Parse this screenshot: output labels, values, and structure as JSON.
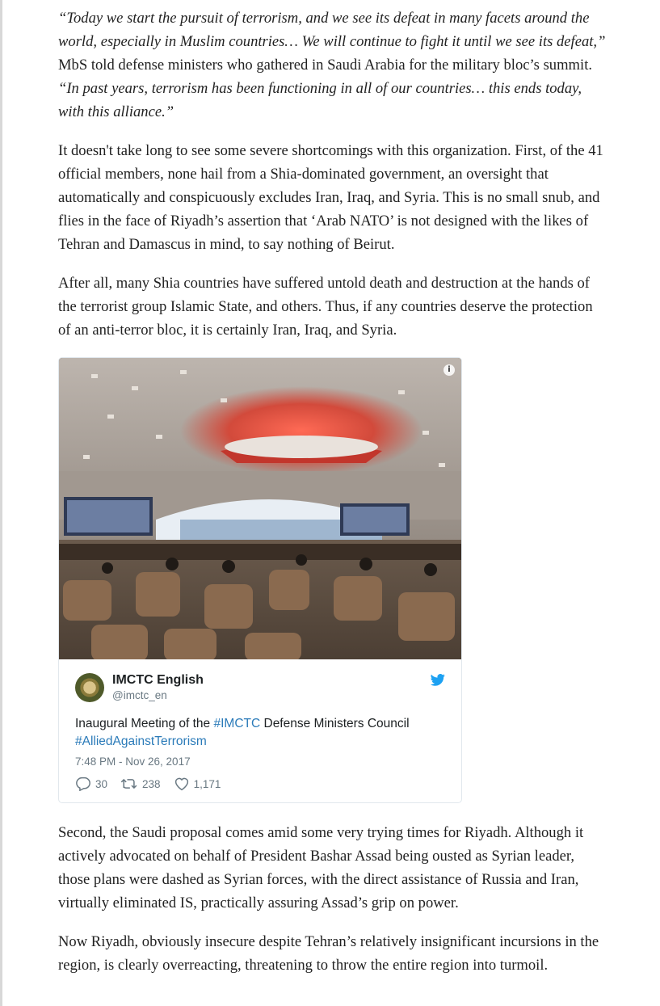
{
  "article": {
    "p1": {
      "q1": "“Today we start the pursuit of terrorism, and we see its defeat in many facets around the world, especially in Muslim countries… We will continue to fight it until we see its defeat,”",
      "plain": " MbS told defense ministers who gathered in Saudi Arabia for the military bloc’s summit. ",
      "q2": "“In past years, terrorism has been functioning in all of our countries… this ends today, with this alliance.”"
    },
    "p2": "It doesn't take long to see some severe shortcomings with this organization. First, of the 41 official members, none hail from a Shia-dominated government, an oversight that automatically and conspicuously excludes Iran, Iraq, and Syria. This is no small snub, and flies in the face of Riyadh’s assertion that ‘Arab NATO’ is not designed with the likes of Tehran and Damascus in mind, to say nothing of Beirut.",
    "p3": "After all, many Shia countries have suffered untold death and destruction at the hands of the terrorist group Islamic State, and others. Thus, if any countries deserve the protection of an anti-terror bloc, it is certainly Iran, Iraq, and Syria.",
    "p4": "Second, the Saudi proposal comes amid some very trying times for Riyadh. Although it actively advocated on behalf of President Bashar Assad being ousted as Syrian leader, those plans were dashed as Syrian forces, with the direct assistance of Russia and Iran, virtually eliminated IS, practically assuring Assad’s grip on power.",
    "p5": "Now Riyadh, obviously insecure despite Tehran’s relatively insignificant incursions in the region, is clearly overreacting, threatening to throw the entire region into turmoil."
  },
  "tweet": {
    "display_name": "IMCTC English",
    "handle": "@imctc_en",
    "text_before": "Inaugural Meeting of the ",
    "hashtag1": "#IMCTC",
    "text_after": " Defense Ministers Council",
    "hashtag2": "#AlliedAgainstTerrorism",
    "timestamp": "7:48 PM - Nov 26, 2017",
    "replies": "30",
    "retweets": "238",
    "likes": "1,171",
    "media_info_glyph": "i",
    "icons": {
      "brand": "twitter-bird-icon",
      "reply": "reply-icon",
      "retweet": "retweet-icon",
      "like": "heart-icon",
      "media_info": "info-icon"
    },
    "colors": {
      "hashtag": "#2b7bb9",
      "bird": "#1da1f2",
      "meta": "#697882"
    }
  }
}
